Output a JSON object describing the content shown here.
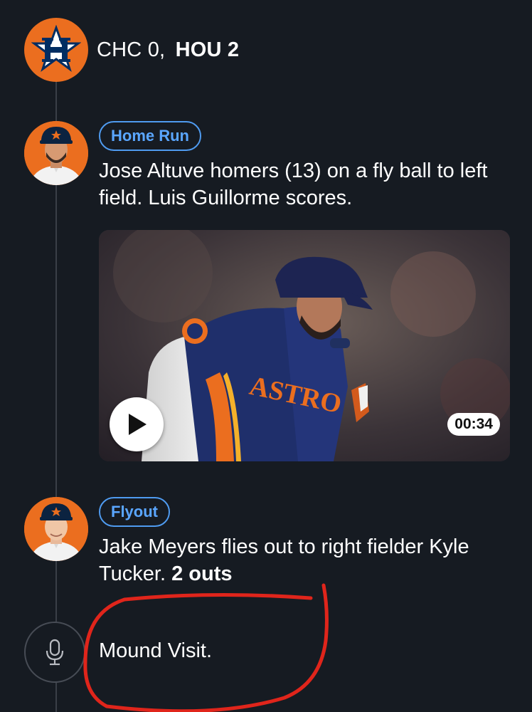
{
  "score": {
    "away_team": "CHC",
    "away_score": "0,",
    "home_team": "HOU",
    "home_score": "2"
  },
  "plays": [
    {
      "badge": "Home Run",
      "description": "Jose Altuve homers (13) on a fly ball to left field. Luis Guillorme scores.",
      "video": {
        "duration": "00:34",
        "jersey_text": "ASTRO"
      }
    },
    {
      "badge": "Flyout",
      "description_main": "Jake Meyers flies out to right fielder Kyle Tucker.",
      "description_bold": "2 outs"
    }
  ],
  "event": {
    "text": "Mound Visit."
  },
  "colors": {
    "background": "#161b22",
    "astros_orange": "#eb6e1f",
    "astros_navy": "#002d62",
    "badge_blue": "#4f9bf0",
    "annotation_red": "#e0251b"
  },
  "icons": {
    "team_logo": "astros-h-star-icon",
    "play": "play-icon",
    "event": "microphone-icon"
  }
}
